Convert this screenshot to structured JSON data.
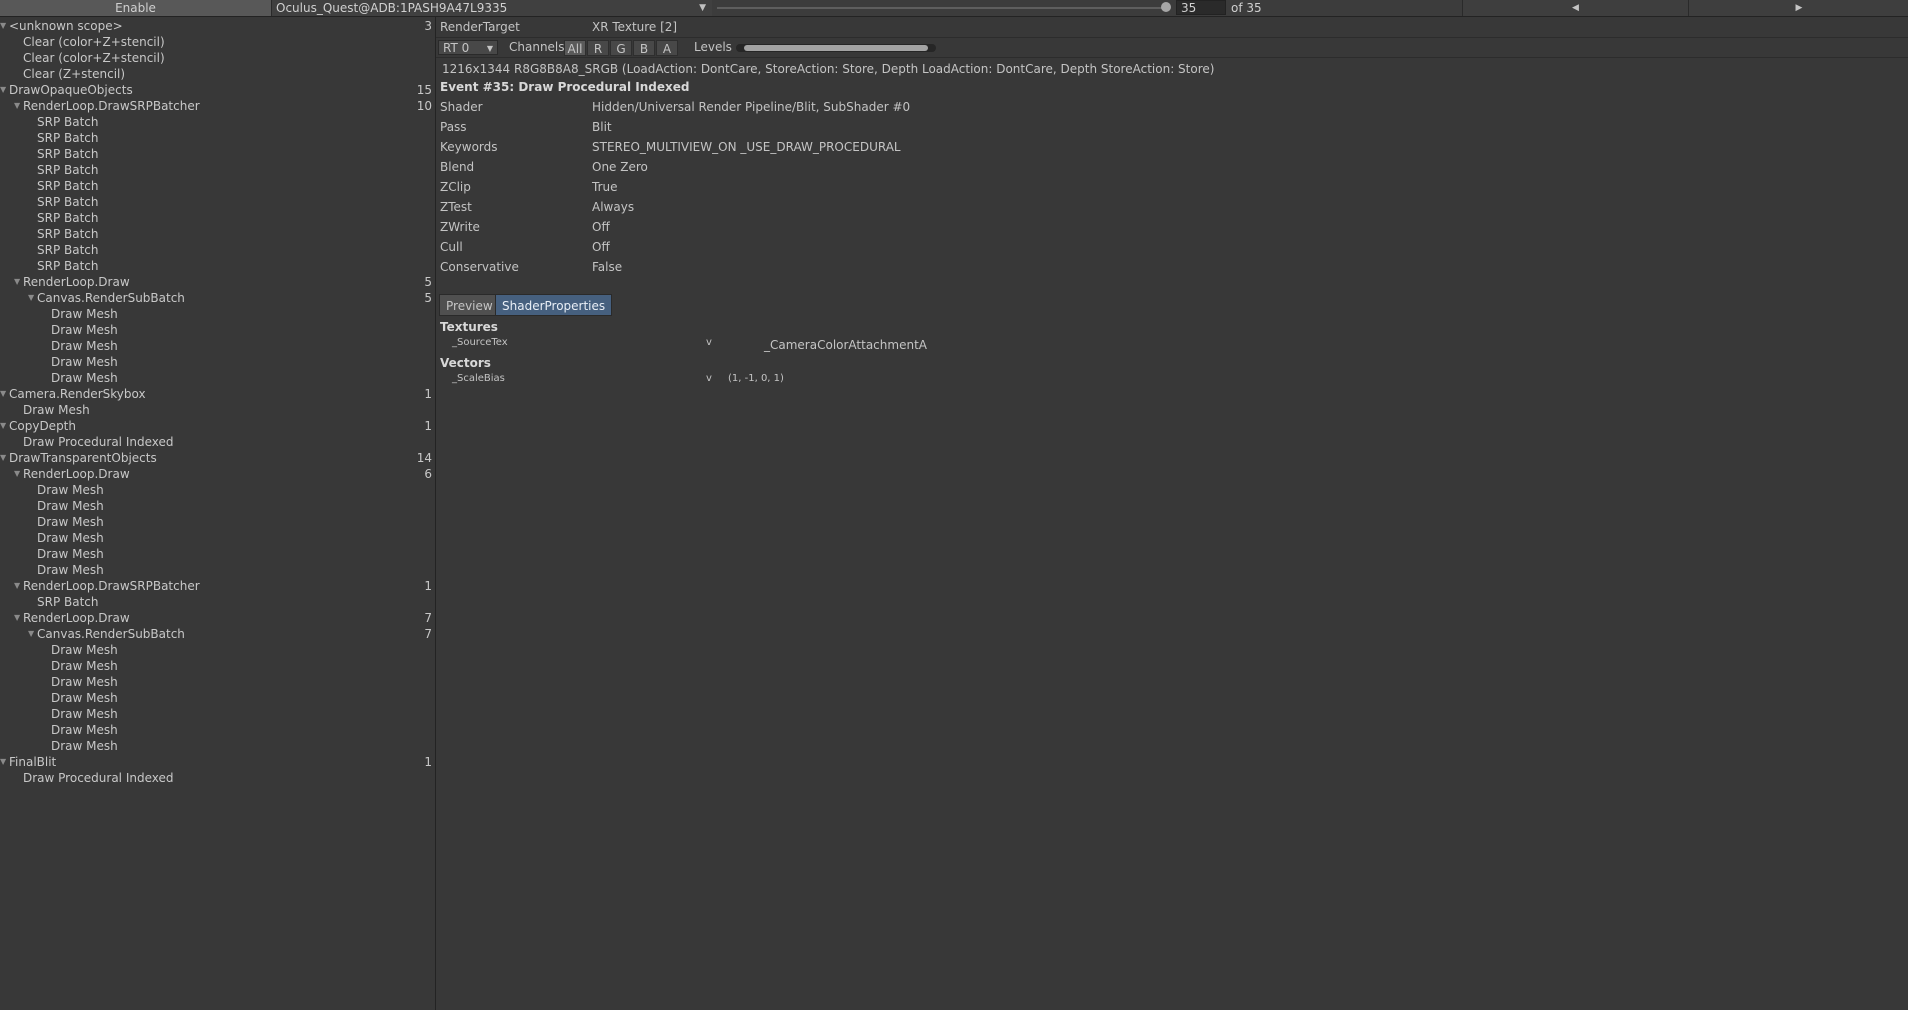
{
  "toolbar": {
    "enable_label": "Enable",
    "device": "Oculus_Quest@ADB:1PASH9A47L9335",
    "dropdown_icon": "chevron-down-icon",
    "event_index": "35",
    "event_of": "of 35",
    "prev_icon": "triangle-left-icon",
    "next_icon": "triangle-right-icon"
  },
  "tree": {
    "rows": [
      {
        "label": "<unknown scope>",
        "count": "3",
        "expanded": true
      },
      {
        "label": "Clear (color+Z+stencil)",
        "count": ""
      },
      {
        "label": "Clear (color+Z+stencil)",
        "count": ""
      },
      {
        "label": "Clear (Z+stencil)",
        "count": ""
      },
      {
        "label": "DrawOpaqueObjects",
        "count": "15",
        "expanded": true
      },
      {
        "label": "RenderLoop.DrawSRPBatcher",
        "count": "10",
        "expanded": true
      },
      {
        "label": "SRP Batch",
        "count": ""
      },
      {
        "label": "SRP Batch",
        "count": ""
      },
      {
        "label": "SRP Batch",
        "count": ""
      },
      {
        "label": "SRP Batch",
        "count": ""
      },
      {
        "label": "SRP Batch",
        "count": ""
      },
      {
        "label": "SRP Batch",
        "count": ""
      },
      {
        "label": "SRP Batch",
        "count": ""
      },
      {
        "label": "SRP Batch",
        "count": ""
      },
      {
        "label": "SRP Batch",
        "count": ""
      },
      {
        "label": "SRP Batch",
        "count": ""
      },
      {
        "label": "RenderLoop.Draw",
        "count": "5",
        "expanded": true
      },
      {
        "label": "Canvas.RenderSubBatch",
        "count": "5",
        "expanded": true
      },
      {
        "label": "Draw Mesh",
        "count": ""
      },
      {
        "label": "Draw Mesh",
        "count": ""
      },
      {
        "label": "Draw Mesh",
        "count": ""
      },
      {
        "label": "Draw Mesh",
        "count": ""
      },
      {
        "label": "Draw Mesh",
        "count": ""
      },
      {
        "label": "Camera.RenderSkybox",
        "count": "1",
        "expanded": true
      },
      {
        "label": "Draw Mesh",
        "count": ""
      },
      {
        "label": "CopyDepth",
        "count": "1",
        "expanded": true
      },
      {
        "label": "Draw Procedural Indexed",
        "count": ""
      },
      {
        "label": "DrawTransparentObjects",
        "count": "14",
        "expanded": true
      },
      {
        "label": "RenderLoop.Draw",
        "count": "6",
        "expanded": true
      },
      {
        "label": "Draw Mesh",
        "count": ""
      },
      {
        "label": "Draw Mesh",
        "count": ""
      },
      {
        "label": "Draw Mesh",
        "count": ""
      },
      {
        "label": "Draw Mesh",
        "count": ""
      },
      {
        "label": "Draw Mesh",
        "count": ""
      },
      {
        "label": "Draw Mesh",
        "count": ""
      },
      {
        "label": "RenderLoop.DrawSRPBatcher",
        "count": "1",
        "expanded": true
      },
      {
        "label": "SRP Batch",
        "count": ""
      },
      {
        "label": "RenderLoop.Draw",
        "count": "7",
        "expanded": true
      },
      {
        "label": "Canvas.RenderSubBatch",
        "count": "7",
        "expanded": true
      },
      {
        "label": "Draw Mesh",
        "count": ""
      },
      {
        "label": "Draw Mesh",
        "count": ""
      },
      {
        "label": "Draw Mesh",
        "count": ""
      },
      {
        "label": "Draw Mesh",
        "count": ""
      },
      {
        "label": "Draw Mesh",
        "count": ""
      },
      {
        "label": "Draw Mesh",
        "count": ""
      },
      {
        "label": "Draw Mesh",
        "count": ""
      },
      {
        "label": "FinalBlit",
        "count": "1",
        "expanded": true
      },
      {
        "label": "Draw Procedural Indexed",
        "count": ""
      }
    ]
  },
  "details": {
    "render_target_label": "RenderTarget",
    "render_target_value": "XR Texture [2]",
    "rt_select": "RT 0",
    "channels_label": "Channels",
    "channels": [
      "All",
      "R",
      "G",
      "B",
      "A"
    ],
    "levels_label": "Levels",
    "format_line": "1216x1344 R8G8B8A8_SRGB (LoadAction: DontCare, StoreAction: Store, Depth LoadAction: DontCare, Depth StoreAction: Store)",
    "event_title": "Event #35: Draw Procedural Indexed",
    "props": [
      {
        "label": "Shader",
        "value": "Hidden/Universal Render Pipeline/Blit, SubShader #0"
      },
      {
        "label": "Pass",
        "value": "Blit"
      },
      {
        "label": "Keywords",
        "value": "STEREO_MULTIVIEW_ON _USE_DRAW_PROCEDURAL"
      },
      {
        "label": "Blend",
        "value": "One Zero"
      },
      {
        "label": "ZClip",
        "value": "True"
      },
      {
        "label": "ZTest",
        "value": "Always"
      },
      {
        "label": "ZWrite",
        "value": "Off"
      },
      {
        "label": "Cull",
        "value": "Off"
      },
      {
        "label": "Conservative",
        "value": "False"
      }
    ],
    "tabs": {
      "preview": "Preview",
      "shader_properties": "ShaderProperties"
    },
    "textures_heading": "Textures",
    "texture": {
      "name": "_SourceTex",
      "stage": "v",
      "value": "_CameraColorAttachmentA"
    },
    "vectors_heading": "Vectors",
    "vector": {
      "name": "_ScaleBias",
      "stage": "v",
      "value": "(1, -1, 0, 1)"
    }
  }
}
